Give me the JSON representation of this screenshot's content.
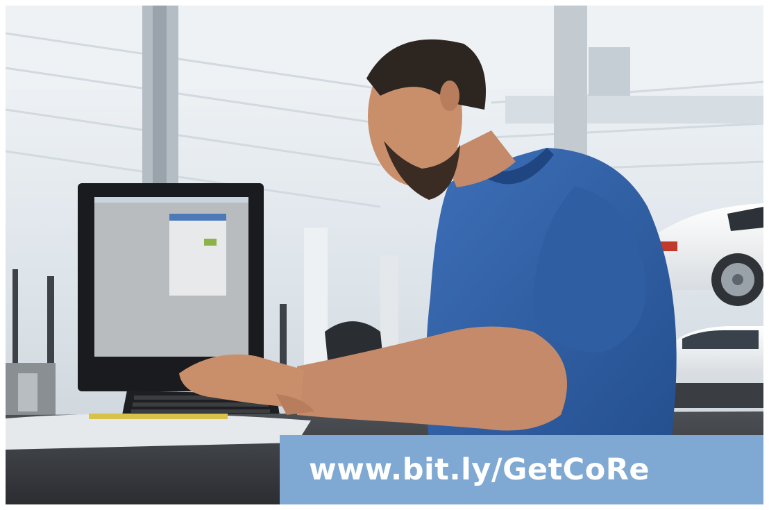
{
  "banner": {
    "url_text": "www.bit.ly/GetCoRe",
    "background_color": "#7fa9d2",
    "text_color": "#ffffff"
  },
  "photo": {
    "subject_icon": "person-at-computer-icon"
  }
}
